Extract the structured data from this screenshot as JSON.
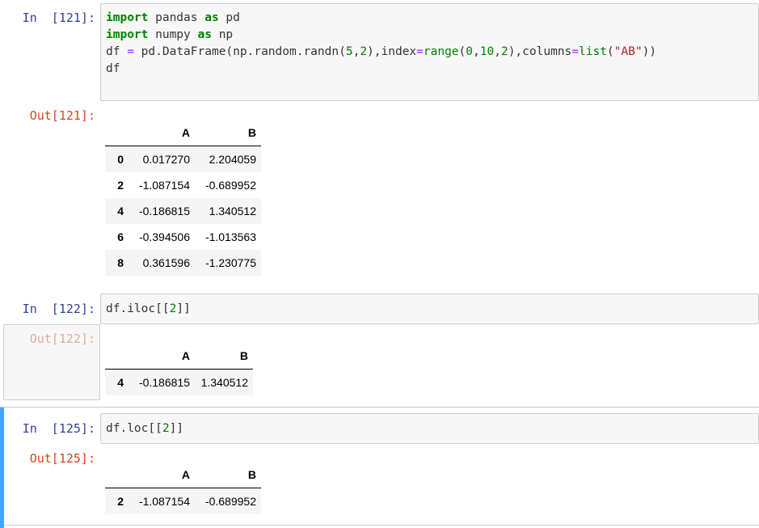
{
  "cells": [
    {
      "in_prompt": "In  [121]:",
      "out_prompt": "Out[121]:",
      "code_lines": [
        "import pandas as pd",
        "import numpy as np",
        "df = pd.DataFrame(np.random.randn(5,2),index=range(0,10,2),columns=list(\"AB\"))",
        "df"
      ],
      "table": {
        "columns": [
          "A",
          "B"
        ],
        "rows": [
          {
            "index": "0",
            "A": "0.017270",
            "B": "2.204059"
          },
          {
            "index": "2",
            "A": "-1.087154",
            "B": "-0.689952"
          },
          {
            "index": "4",
            "A": "-0.186815",
            "B": "1.340512"
          },
          {
            "index": "6",
            "A": "-0.394506",
            "B": "-1.013563"
          },
          {
            "index": "8",
            "A": "0.361596",
            "B": "-1.230775"
          }
        ]
      }
    },
    {
      "in_prompt": "In  [122]:",
      "out_prompt": "Out[122]:",
      "code_lines": [
        "df.iloc[[2]]"
      ],
      "table": {
        "columns": [
          "A",
          "B"
        ],
        "rows": [
          {
            "index": "4",
            "A": "-0.186815",
            "B": "1.340512"
          }
        ]
      }
    },
    {
      "in_prompt": "In  [125]:",
      "out_prompt": "Out[125]:",
      "code_lines": [
        "df.loc[[2]]"
      ],
      "table": {
        "columns": [
          "A",
          "B"
        ],
        "rows": [
          {
            "index": "2",
            "A": "-1.087154",
            "B": "-0.689952"
          }
        ]
      }
    }
  ],
  "colors": {
    "in_prompt": "#303f9f",
    "out_prompt": "#d84315",
    "selected_bar": "#42a5f5",
    "code_background": "#f7f7f7"
  }
}
